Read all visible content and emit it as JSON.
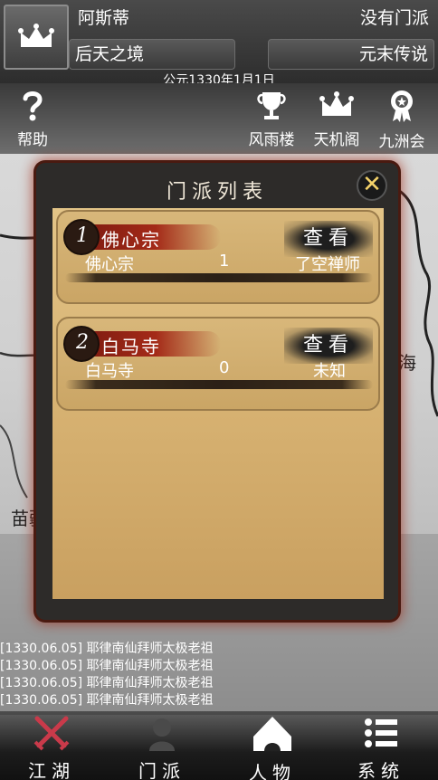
{
  "header": {
    "player_name": "阿斯蒂",
    "sect_status": "没有门派",
    "realm": "后天之境",
    "title": "元末传说",
    "date": "公元1330年1月1日"
  },
  "icon_bar": [
    {
      "label": "帮助",
      "icon": "question-icon"
    },
    {
      "label": "风雨楼",
      "icon": "trophy-icon"
    },
    {
      "label": "天机阁",
      "icon": "crown-icon"
    },
    {
      "label": "九洲会",
      "icon": "medal-icon"
    }
  ],
  "map": {
    "labels": [
      "海",
      "苗疆"
    ]
  },
  "modal": {
    "title": "门派列表",
    "close_label": "✕",
    "sects": [
      {
        "rank": "1",
        "badge_name": "佛心宗",
        "view_label": "查看",
        "name": "佛心宗",
        "count": "1",
        "leader": "了空禅师"
      },
      {
        "rank": "2",
        "badge_name": "白马寺",
        "view_label": "查看",
        "name": "白马寺",
        "count": "0",
        "leader": "未知"
      }
    ]
  },
  "log": [
    "[1330.06.05] 耶律南仙拜师太极老祖",
    "[1330.06.05] 耶律南仙拜师太极老祖",
    "[1330.06.05] 耶律南仙拜师太极老祖",
    "[1330.06.05] 耶律南仙拜师太极老祖"
  ],
  "bottom_nav": [
    {
      "label": "江湖",
      "icon": "crossed-swords-icon",
      "color": "#c93a4a"
    },
    {
      "label": "门派",
      "icon": "sect-icon"
    },
    {
      "label": "人物",
      "icon": "character-icon"
    },
    {
      "label": "系统",
      "icon": "list-icon"
    }
  ]
}
